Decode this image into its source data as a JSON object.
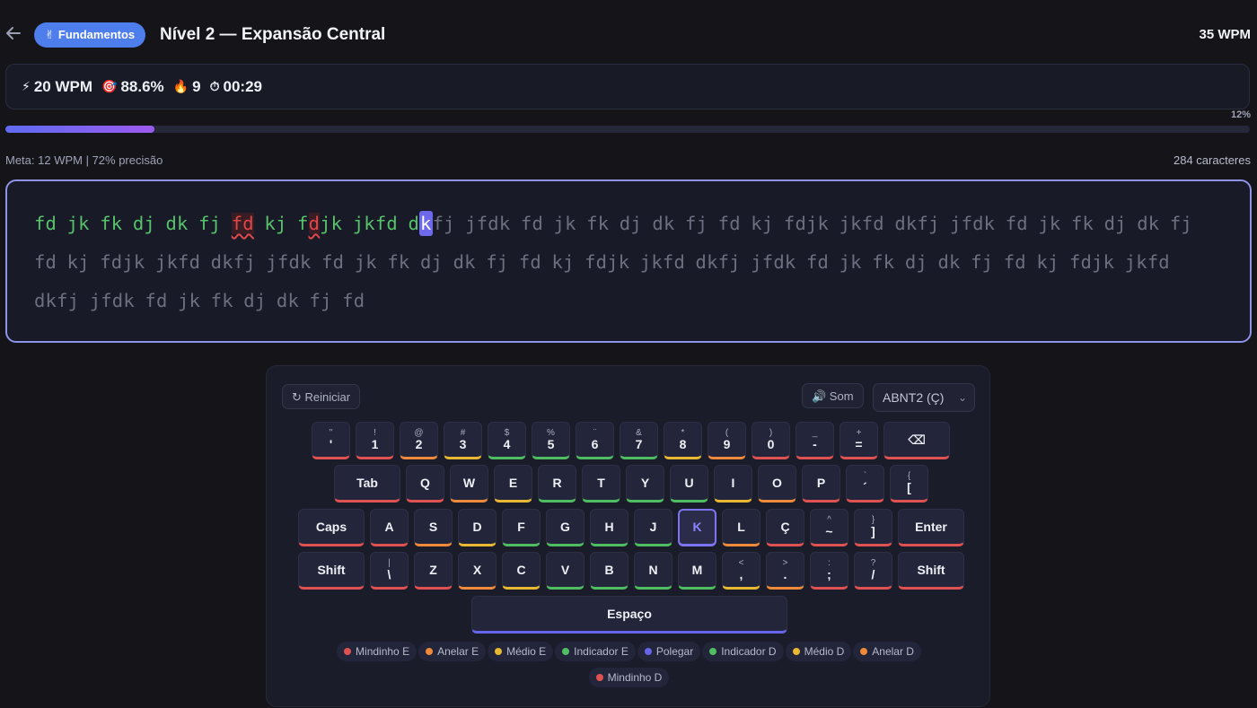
{
  "header": {
    "back_icon": "arrow-left-icon",
    "badge_emoji": "✌",
    "badge_label": "Fundamentos",
    "title": "Nível 2 — Expansão Central",
    "wpm": "35 WPM"
  },
  "stats": {
    "speed": "20 WPM",
    "accuracy": "88.6%",
    "streak": "9",
    "time": "00:29"
  },
  "progress": {
    "percent_label": "12%",
    "value": 0.12
  },
  "meta": {
    "goal": "Meta: 12 WPM | 72% precisão",
    "chars": "284 caracteres"
  },
  "text": {
    "typed": [
      {
        "t": "fd jk fk dj dk fj ",
        "s": "ok"
      },
      {
        "t": "fd",
        "s": "err"
      },
      {
        "t": " kj f",
        "s": "ok"
      },
      {
        "t": "d",
        "s": "err"
      },
      {
        "t": "jk jkfd d",
        "s": "ok"
      },
      {
        "t": "k",
        "s": "cur"
      }
    ],
    "remaining": "fj jfdk fd jk fk dj dk fj fd kj fdjk jkfd dkfj jfdk fd jk fk dj dk fj fd kj fdjk jkfd dkfj jfdk fd jk fk dj dk fj fd kj fdjk jkfd dkfj jfdk fd jk fk dj dk fj fd kj fdjk jkfd dkfj jfdk fd jk fk dj dk fj fd"
  },
  "controls": {
    "reset_label": "↻ Reiniciar",
    "sound_label": "🔊 Som",
    "layout_label": "ABNT2 (Ç)"
  },
  "keyboard": {
    "rows": [
      [
        {
          "s": "\"",
          "m": "'",
          "f": "r"
        },
        {
          "s": "!",
          "m": "1",
          "f": "r"
        },
        {
          "s": "@",
          "m": "2",
          "f": "o"
        },
        {
          "s": "#",
          "m": "3",
          "f": "y"
        },
        {
          "s": "$",
          "m": "4",
          "f": "g"
        },
        {
          "s": "%",
          "m": "5",
          "f": "g"
        },
        {
          "s": "¨",
          "m": "6",
          "f": "g"
        },
        {
          "s": "&",
          "m": "7",
          "f": "g"
        },
        {
          "s": "*",
          "m": "8",
          "f": "y"
        },
        {
          "s": "(",
          "m": "9",
          "f": "o"
        },
        {
          "s": ")",
          "m": "0",
          "f": "r"
        },
        {
          "s": "_",
          "m": "-",
          "f": "r"
        },
        {
          "s": "+",
          "m": "=",
          "f": "r"
        },
        {
          "s": "",
          "m": "⌫",
          "f": "r",
          "w": "wide"
        }
      ],
      [
        {
          "s": "",
          "m": "Tab",
          "f": "r"
        },
        {
          "s": "",
          "m": "Q",
          "f": "r"
        },
        {
          "s": "",
          "m": "W",
          "f": "o"
        },
        {
          "s": "",
          "m": "E",
          "f": "y"
        },
        {
          "s": "",
          "m": "R",
          "f": "g"
        },
        {
          "s": "",
          "m": "T",
          "f": "g"
        },
        {
          "s": "",
          "m": "Y",
          "f": "g"
        },
        {
          "s": "",
          "m": "U",
          "f": "g"
        },
        {
          "s": "",
          "m": "I",
          "f": "y"
        },
        {
          "s": "",
          "m": "O",
          "f": "o"
        },
        {
          "s": "",
          "m": "P",
          "f": "r"
        },
        {
          "s": "`",
          "m": "´",
          "f": "r"
        },
        {
          "s": "{",
          "m": "[",
          "f": "r"
        }
      ],
      [
        {
          "s": "",
          "m": "Caps",
          "f": "r"
        },
        {
          "s": "",
          "m": "A",
          "f": "r"
        },
        {
          "s": "",
          "m": "S",
          "f": "o"
        },
        {
          "s": "",
          "m": "D",
          "f": "y"
        },
        {
          "s": "",
          "m": "F",
          "f": "g"
        },
        {
          "s": "",
          "m": "G",
          "f": "g"
        },
        {
          "s": "",
          "m": "H",
          "f": "g"
        },
        {
          "s": "",
          "m": "J",
          "f": "g"
        },
        {
          "s": "",
          "m": "K",
          "f": "y",
          "active": true
        },
        {
          "s": "",
          "m": "L",
          "f": "o"
        },
        {
          "s": "",
          "m": "Ç",
          "f": "r"
        },
        {
          "s": "^",
          "m": "~",
          "f": "r"
        },
        {
          "s": "}",
          "m": "]",
          "f": "r"
        },
        {
          "s": "",
          "m": "Enter",
          "f": "r"
        }
      ],
      [
        {
          "s": "",
          "m": "Shift",
          "f": "r"
        },
        {
          "s": "|",
          "m": "\\",
          "f": "r"
        },
        {
          "s": "",
          "m": "Z",
          "f": "r"
        },
        {
          "s": "",
          "m": "X",
          "f": "o"
        },
        {
          "s": "",
          "m": "C",
          "f": "y"
        },
        {
          "s": "",
          "m": "V",
          "f": "g"
        },
        {
          "s": "",
          "m": "B",
          "f": "g"
        },
        {
          "s": "",
          "m": "N",
          "f": "g"
        },
        {
          "s": "",
          "m": "M",
          "f": "g"
        },
        {
          "s": "<",
          "m": ",",
          "f": "y"
        },
        {
          "s": ">",
          "m": ".",
          "f": "o"
        },
        {
          "s": ":",
          "m": ";",
          "f": "r"
        },
        {
          "s": "?",
          "m": "/",
          "f": "r"
        },
        {
          "s": "",
          "m": "Shift",
          "f": "r"
        }
      ],
      [
        {
          "s": "",
          "m": "Espaço",
          "f": "b"
        }
      ]
    ]
  },
  "legend": [
    {
      "label": "Mindinho E",
      "color": "#e05252"
    },
    {
      "label": "Anelar E",
      "color": "#ef8a3a"
    },
    {
      "label": "Médio E",
      "color": "#e8b833"
    },
    {
      "label": "Indicador E",
      "color": "#4fbe62"
    },
    {
      "label": "Polegar",
      "color": "#6566ea"
    },
    {
      "label": "Indicador D",
      "color": "#4fbe62"
    },
    {
      "label": "Médio D",
      "color": "#e8b833"
    },
    {
      "label": "Anelar D",
      "color": "#ef8a3a"
    },
    {
      "label": "Mindinho D",
      "color": "#e05252"
    }
  ]
}
